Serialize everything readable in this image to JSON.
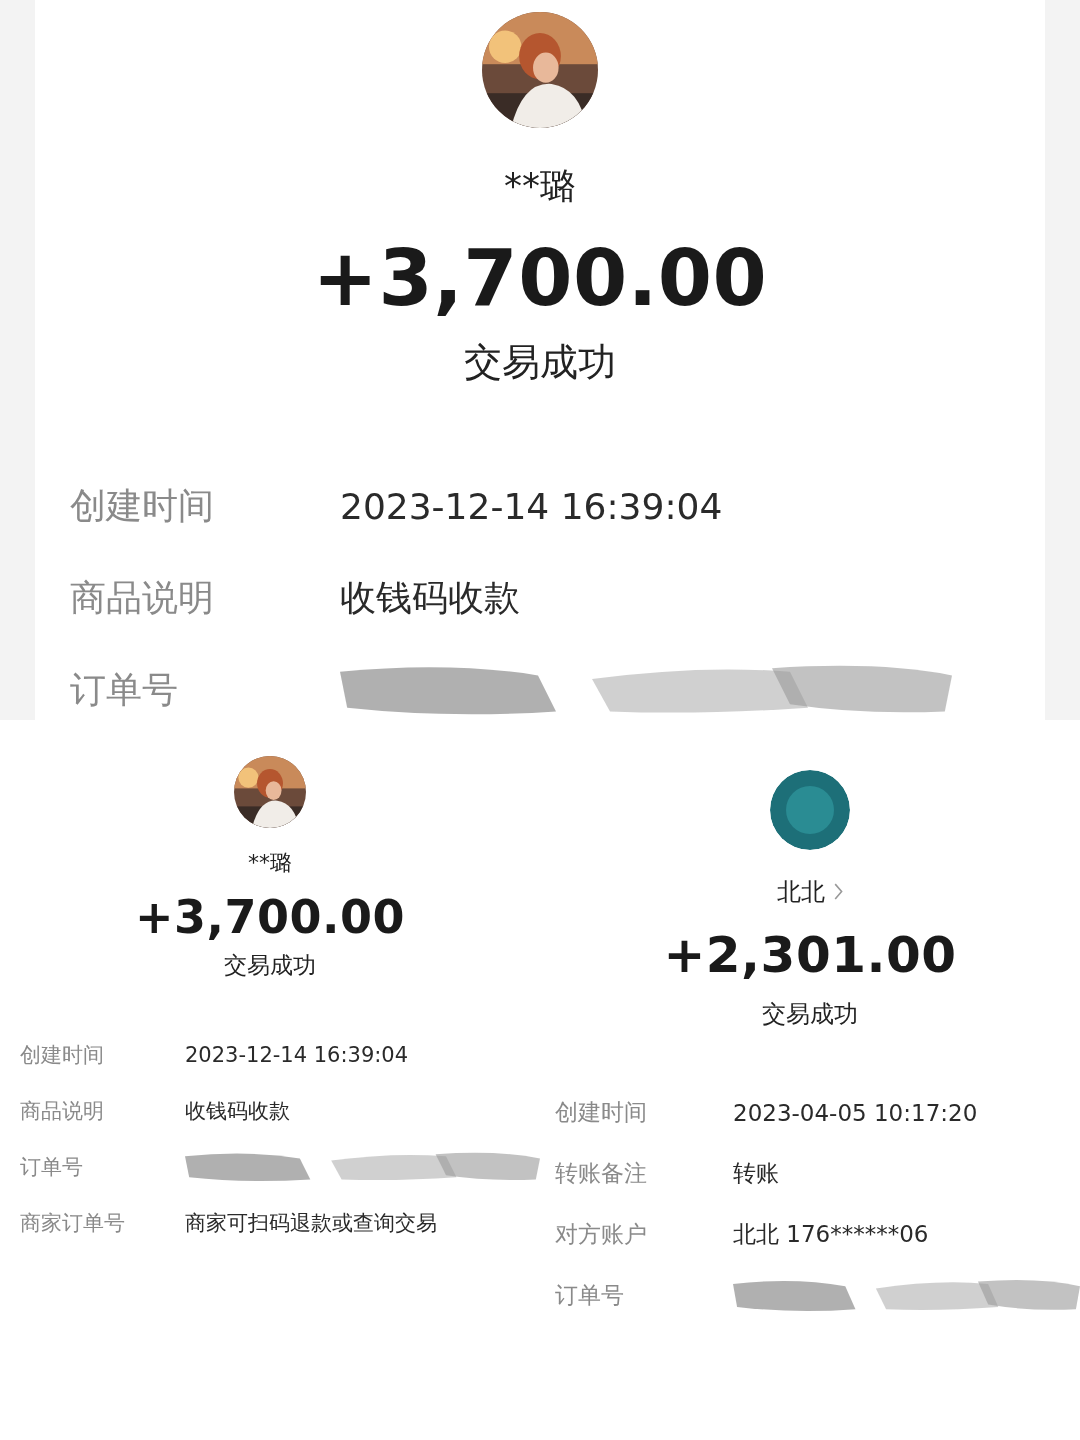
{
  "receipts": [
    {
      "avatar": {
        "kind": "picture"
      },
      "name": "**璐",
      "name_link": false,
      "amount": "+3,700.00",
      "status": "交易成功",
      "details": [
        {
          "kind": "text",
          "label": "创建时间",
          "value": "2023-12-14 16:39:04"
        },
        {
          "kind": "text",
          "label": "商品说明",
          "value": "收钱码收款"
        },
        {
          "kind": "redacted",
          "label": "订单号"
        }
      ]
    },
    {
      "avatar": {
        "kind": "picture"
      },
      "name": "**璐",
      "name_link": false,
      "amount": "+3,700.00",
      "status": "交易成功",
      "details": [
        {
          "kind": "text",
          "label": "创建时间",
          "value": "2023-12-14 16:39:04"
        },
        {
          "kind": "text",
          "label": "商品说明",
          "value": "收钱码收款"
        },
        {
          "kind": "redacted",
          "label": "订单号"
        },
        {
          "kind": "text",
          "label": "商家订单号",
          "value": "商家可扫码退款或查询交易"
        }
      ]
    },
    {
      "avatar": {
        "kind": "logo"
      },
      "name": "北北",
      "name_link": true,
      "amount": "+2,301.00",
      "status": "交易成功",
      "details": [
        {
          "kind": "text",
          "label": "创建时间",
          "value": "2023-04-05 10:17:20"
        },
        {
          "kind": "text",
          "label": "转账备注",
          "value": "转账"
        },
        {
          "kind": "text",
          "label": "对方账户",
          "value": "北北 176******06"
        },
        {
          "kind": "redacted",
          "label": "订单号"
        }
      ]
    }
  ]
}
